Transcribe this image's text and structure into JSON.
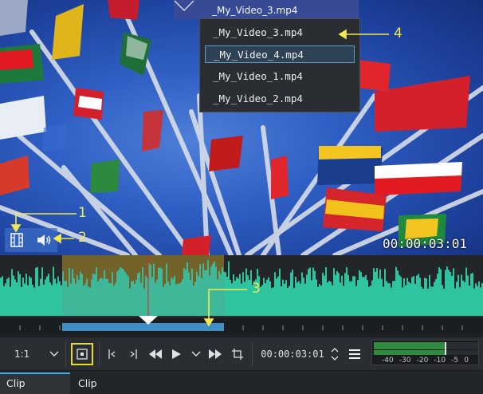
{
  "clip_title": "_My_Video_3.mp4",
  "clip_menu": {
    "items": [
      "_My_Video_3.mp4",
      "_My_Video_4.mp4",
      "_My_Video_1.mp4",
      "_My_Video_2.mp4"
    ],
    "selected_index": 1
  },
  "video_timecode": "00:00:03:01",
  "annotations": {
    "a1": "1",
    "a2": "2",
    "a3": "3",
    "a4": "4"
  },
  "toolbar": {
    "zoom_value": "1:1",
    "timecode": "00:00:03:01",
    "icons": [
      "chevron-down-icon",
      "zone-select-icon",
      "set-zone-in-icon",
      "set-zone-out-icon",
      "rewind-icon",
      "play-icon",
      "chevron-down-icon",
      "forward-icon",
      "crop-icon",
      "spin-arrows-icon",
      "menu-icon"
    ]
  },
  "audio_meter": {
    "labels": [
      "-40",
      "-30",
      "-20",
      "-10",
      "-5",
      "0"
    ]
  },
  "tabs": [
    {
      "label": "Clip Monitor",
      "active": true
    },
    {
      "label": "Clip Properties",
      "active": false
    }
  ],
  "colors": {
    "accent": "#3daee9",
    "annotation": "#f2e94e",
    "waveform": "#2ec4a0",
    "zone": "#3d8fc6"
  }
}
